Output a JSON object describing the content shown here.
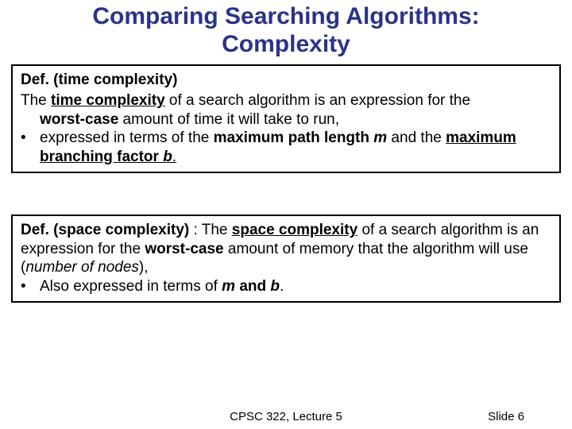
{
  "title_line1": "Comparing Searching Algorithms:",
  "title_line2": "Complexity",
  "box1": {
    "def_label": "Def. (time complexity)",
    "the": "The ",
    "time_complexity": "time complexity",
    "body_rest": " of a search algorithm is an expression for the ",
    "worst_case": "worst-case",
    "body_tail": " amount of time it will take to run,",
    "bullet_dot": "•",
    "bullet_pre": "expressed in terms of the ",
    "max_path": "maximum path length ",
    "m": "m",
    "and_the": " and the ",
    "max_branch": "maximum branching factor ",
    "b": "b",
    "period": "."
  },
  "box2": {
    "def_label": "Def. (space complexity)",
    "colon_the": " : The ",
    "space_complexity": "space complexity",
    "body_rest": " of a search algorithm is an expression for the ",
    "worst_case": "worst-case",
    "body_tail": " amount of memory that the algorithm will use (",
    "num_nodes": "number of nodes",
    "paren_comma": "),",
    "bullet_dot": "•",
    "bullet_pre": "Also expressed in terms of ",
    "m": "m",
    "and": " and ",
    "b": "b",
    "period": "."
  },
  "footer": {
    "center": "CPSC 322, Lecture 5",
    "right": "Slide 6"
  }
}
